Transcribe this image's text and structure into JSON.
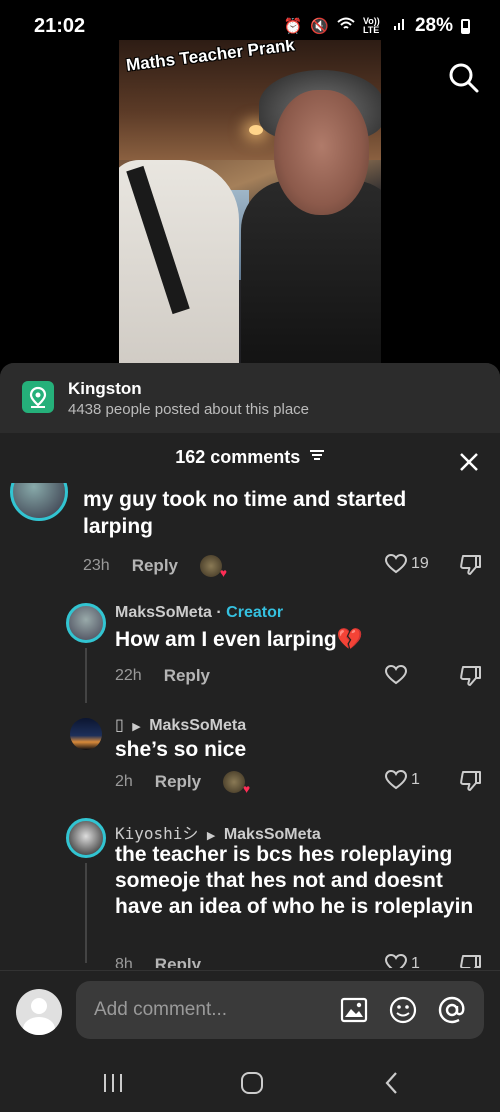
{
  "status_bar": {
    "time": "21:02",
    "network": "Vo)) LTE",
    "battery": "28%"
  },
  "video": {
    "caption": "Maths Teacher Prank"
  },
  "location": {
    "title": "Kingston",
    "subtitle": "4438 people posted about this place"
  },
  "comments_header": {
    "count_label": "162 comments"
  },
  "comments": [
    {
      "text": "my guy took no time and started larping",
      "time": "23h",
      "reply_label": "Reply",
      "likes": "19"
    },
    {
      "author": "MaksSoMeta",
      "separator": "·",
      "badge": "Creator",
      "text": "How am I even larping💔",
      "time": "22h",
      "reply_label": "Reply",
      "likes": ""
    },
    {
      "author_glyph": "▯",
      "reply_to": "MaksSoMeta",
      "text": "she’s so nice",
      "time": "2h",
      "reply_label": "Reply",
      "likes": "1"
    },
    {
      "author": "Kiyoshiシ",
      "reply_to": "MaksSoMeta",
      "text": "the teacher is bcs hes roleplaying someoje that hes not and doesnt have an idea of who he is roleplayin",
      "time": "8h",
      "reply_label": "Reply",
      "likes": "1"
    }
  ],
  "composer": {
    "placeholder": "Add comment..."
  },
  "icons": {
    "accent": "#32c5d2",
    "location_color": "#25b07a",
    "heart_color": "#ff2d55"
  }
}
